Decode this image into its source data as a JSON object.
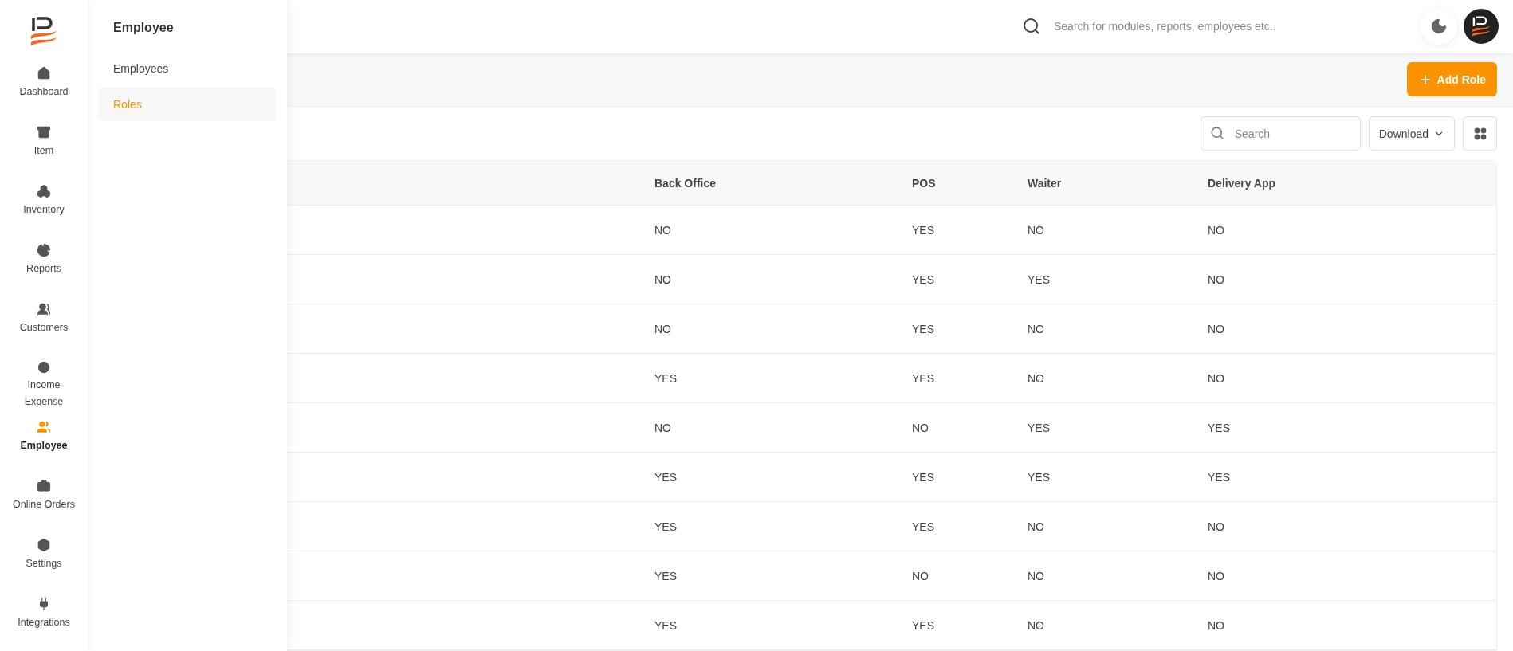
{
  "rail": [
    {
      "label": "Dashboard",
      "selected": false
    },
    {
      "label": "Item",
      "selected": false
    },
    {
      "label": "Inventory",
      "selected": false
    },
    {
      "label": "Reports",
      "selected": false
    },
    {
      "label": "Customers",
      "selected": false
    },
    {
      "label": "Income Expense",
      "selected": false
    },
    {
      "label": "Employee",
      "selected": true
    },
    {
      "label": "Online Orders",
      "selected": false
    },
    {
      "label": "Settings",
      "selected": false
    },
    {
      "label": "Integrations",
      "selected": false
    }
  ],
  "submenu": {
    "title": "Employee",
    "items": [
      {
        "label": "Employees",
        "selected": false
      },
      {
        "label": "Roles",
        "selected": true
      }
    ]
  },
  "header": {
    "search_placeholder": "Search for modules, reports, employees etc.."
  },
  "toolbar": {
    "add_button": "Add Role",
    "search_placeholder": "Search",
    "download": "Download"
  },
  "table": {
    "columns": [
      "Back Office",
      "POS",
      "Waiter",
      "Delivery App"
    ],
    "rows": [
      [
        "NO",
        "YES",
        "NO",
        "NO"
      ],
      [
        "NO",
        "YES",
        "YES",
        "NO"
      ],
      [
        "NO",
        "YES",
        "NO",
        "NO"
      ],
      [
        "YES",
        "YES",
        "NO",
        "NO"
      ],
      [
        "NO",
        "NO",
        "YES",
        "YES"
      ],
      [
        "YES",
        "YES",
        "YES",
        "YES"
      ],
      [
        "YES",
        "YES",
        "NO",
        "NO"
      ],
      [
        "YES",
        "NO",
        "NO",
        "NO"
      ],
      [
        "YES",
        "YES",
        "NO",
        "NO"
      ]
    ]
  }
}
